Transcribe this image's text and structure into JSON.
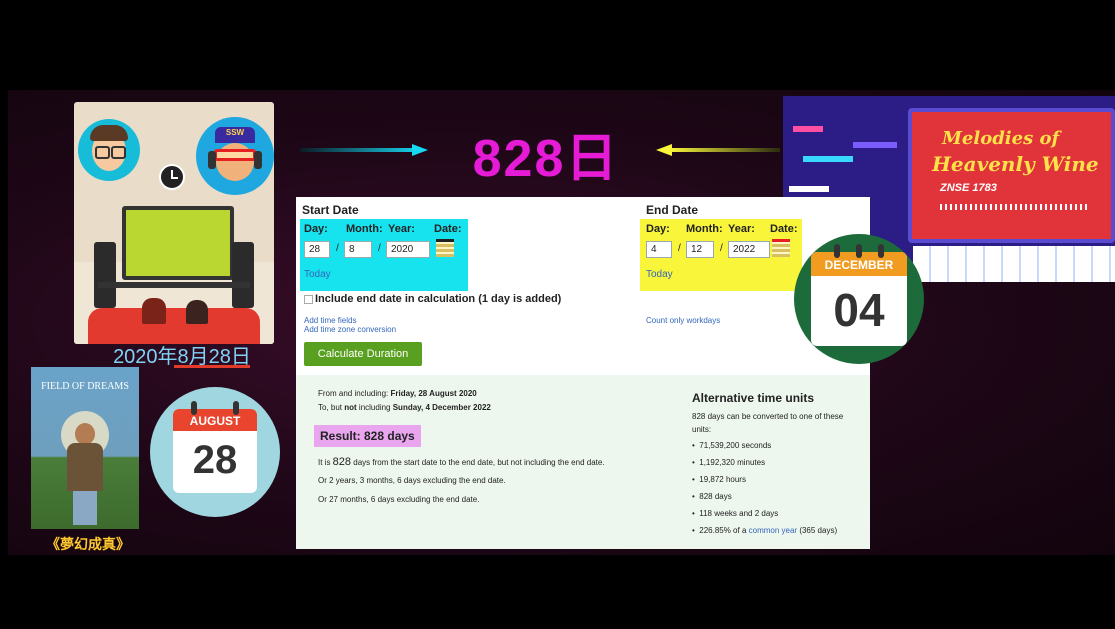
{
  "headline": "828日",
  "left_date_caption": "2020年8月28日",
  "avatar_badge": "SSW",
  "movie": {
    "poster_title": "FIELD OF DREAMS",
    "caption": "《夢幻成真》"
  },
  "calendar_left": {
    "month": "AUGUST",
    "day": "28"
  },
  "calendar_right": {
    "month": "DECEMBER",
    "day": "04"
  },
  "album": {
    "title_line1": "Melodies of",
    "title_line2": "Heavenly Wine",
    "code": "ZNSE 1783"
  },
  "calculator": {
    "start": {
      "heading": "Start Date",
      "day_label": "Day:",
      "month_label": "Month:",
      "year_label": "Year:",
      "date_label": "Date:",
      "day": "28",
      "month": "8",
      "year": "2020",
      "today": "Today"
    },
    "end": {
      "heading": "End Date",
      "day_label": "Day:",
      "month_label": "Month:",
      "year_label": "Year:",
      "date_label": "Date:",
      "day": "4",
      "month": "12",
      "year": "2022",
      "today": "Today"
    },
    "include_end": "Include end date in calculation (1 day is added)",
    "add_time_fields": "Add time fields",
    "add_timezone": "Add time zone conversion",
    "count_workdays": "Count only workdays",
    "calc_button": "Calculate Duration",
    "from_line_prefix": "From and including: ",
    "from_line_value": "Friday, 28 August 2020",
    "to_line_prefix": "To, but ",
    "to_line_not": "not",
    "to_line_mid": " including ",
    "to_line_value": "Sunday, 4 December 2022",
    "result": "Result: 828 days",
    "explain1_pre": "It is ",
    "explain1_num": "828",
    "explain1_post": " days from the start date to the end date, but not including the end date.",
    "explain2": "Or 2 years, 3 months, 6 days excluding the end date.",
    "explain3": "Or 27 months, 6 days excluding the end date.",
    "alt_heading": "Alternative time units",
    "alt_intro": "828 days can be converted to one of these units:",
    "alt_units": [
      "71,539,200 seconds",
      "1,192,320 minutes",
      "19,872 hours",
      "828 days",
      "118 weeks and 2 days"
    ],
    "alt_last_pre": "226.85% of a ",
    "alt_last_link": "common year",
    "alt_last_post": " (365 days)"
  },
  "colors": {
    "headline": "#e61bd6",
    "cyan_box": "#17e3ef",
    "yellow_box": "#f8f53a",
    "result_bg": "#e9a6ef",
    "button": "#5aa020",
    "calendar_red": "#e8442e",
    "calendar_orange": "#f19b20",
    "calendar_green_ring": "#1d6b3a"
  }
}
